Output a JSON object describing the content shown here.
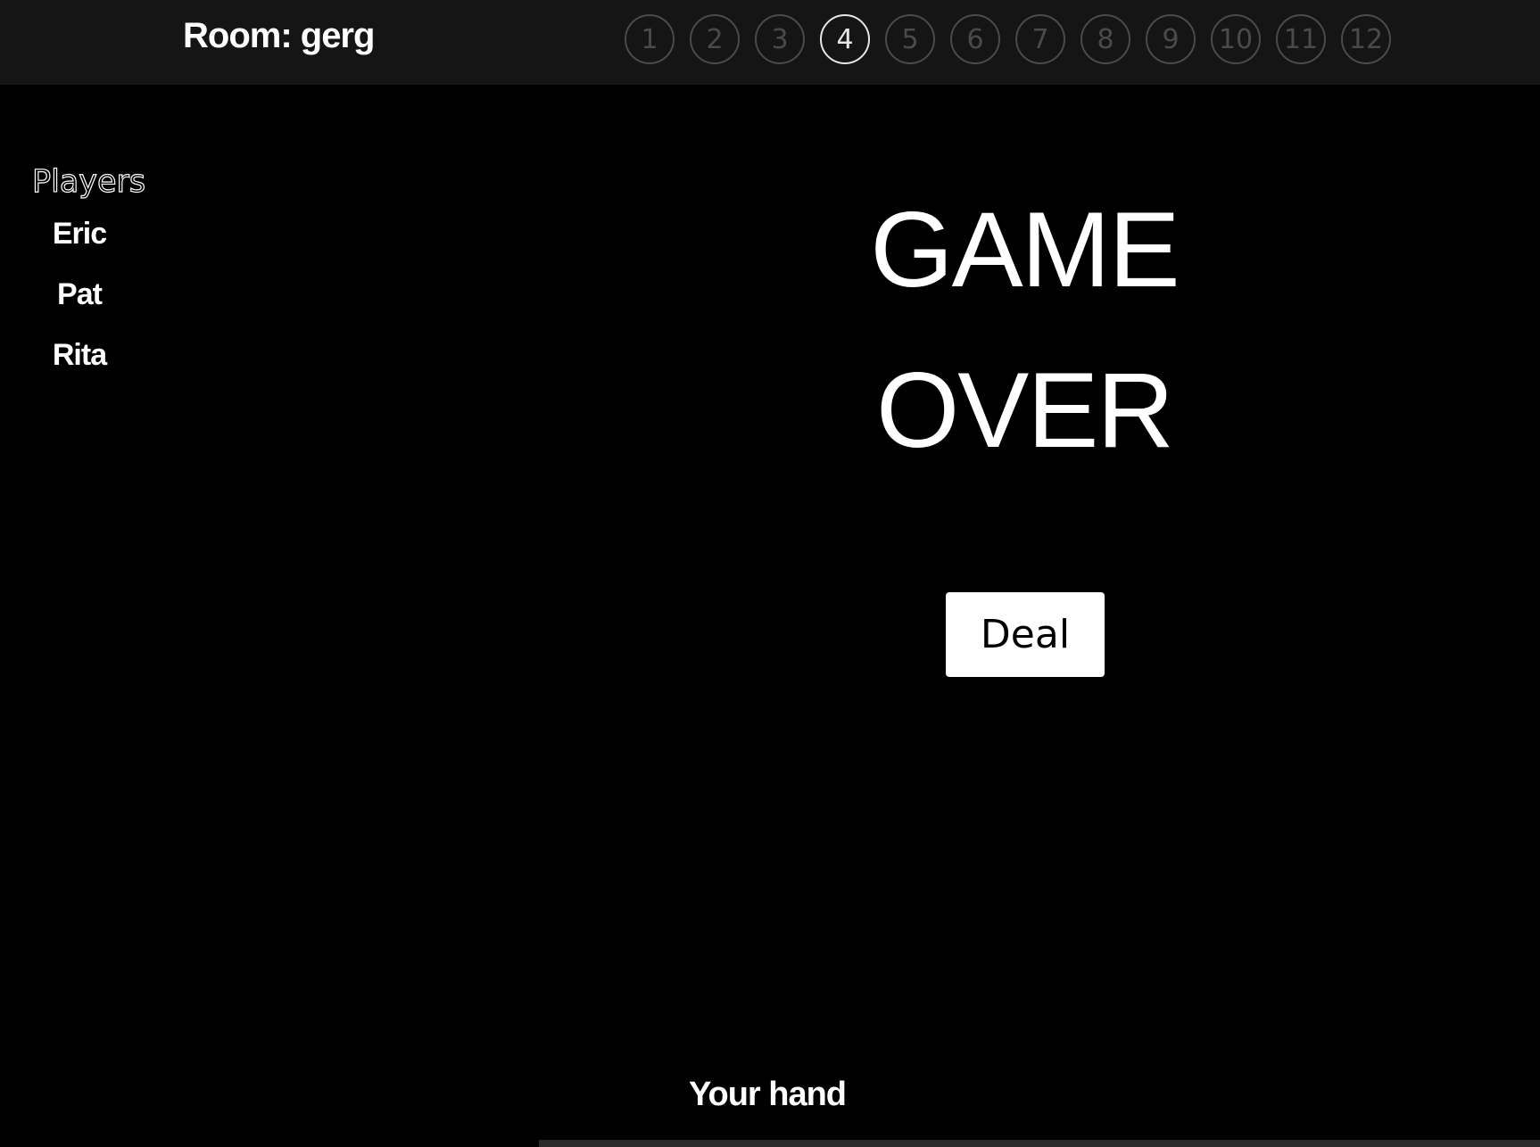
{
  "header": {
    "room_label": "Room: gerg",
    "rounds": [
      "1",
      "2",
      "3",
      "4",
      "5",
      "6",
      "7",
      "8",
      "9",
      "10",
      "11",
      "12"
    ],
    "active_round": "4"
  },
  "players": {
    "heading": "Players",
    "names": [
      "Eric",
      "Pat",
      "Rita"
    ]
  },
  "main": {
    "status_line1": "GAME",
    "status_line2": "OVER",
    "deal_label": "Deal"
  },
  "hand": {
    "label": "Your hand"
  }
}
